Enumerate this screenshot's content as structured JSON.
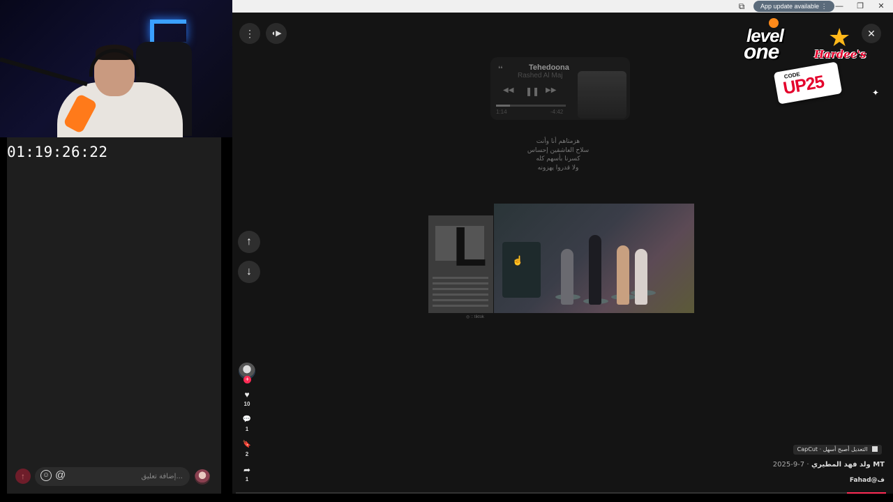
{
  "stream": {
    "timer": "01:19:26:22"
  },
  "browser": {
    "update_label": "App update available",
    "update_menu_icon": "⋮",
    "extensions_icon": "puzzle-icon",
    "minimize": "—",
    "restore": "❐",
    "close": "✕"
  },
  "viewer": {
    "more_icon": "⋮",
    "audio_icon": "◖▶",
    "prev_icon": "↑",
    "next_icon": "↓",
    "close_icon": "✕",
    "cursor_icon": "☝"
  },
  "music_card": {
    "title": "Tehedoona",
    "artist": "Rashed Al Maj",
    "prev_icon": "◀◀",
    "pause_icon": "❚❚",
    "next_icon": "▶▶",
    "airpods_icon": "❛❛",
    "elapsed": "1:14",
    "remaining": "-4:42"
  },
  "lyrics": [
    "هزمتاهم أنا وأنت",
    "سلاح العاشقين إحساس",
    "كسرنا بأسهم كله",
    "ولا قدروا يهزونه"
  ],
  "video_watermark": "◎ :: tiktok",
  "actions": {
    "like_icon": "♥",
    "likes": "10",
    "comment_icon": "💬",
    "comments": "1",
    "save_icon": "🔖",
    "saves": "2",
    "share_icon": "➦",
    "shares": "1",
    "follow_icon": "+"
  },
  "video_info": {
    "capcut_tag": "CapCut · التعديل أصبح أسهل",
    "title": "ولد فهد المطيري MT",
    "date": "2025-9-7 ·",
    "handle": "Fahad@ف",
    "progress_fraction": 0.06
  },
  "comment_box": {
    "placeholder": "إضافة تعليق...",
    "emoji_icon": "☺",
    "mention_icon": "@",
    "send_icon": "↑"
  },
  "sponsor": {
    "level_line1": "level",
    "level_line2": "one",
    "hardees": "Hardee's",
    "code_label": "CODE",
    "code": "UP25",
    "sparkle": "✦"
  },
  "colors": {
    "accent": "#fe2c55",
    "hardees_red": "#e4002b",
    "mic_orange": "#ff7a1a",
    "neon_blue": "#3aa0ff"
  }
}
